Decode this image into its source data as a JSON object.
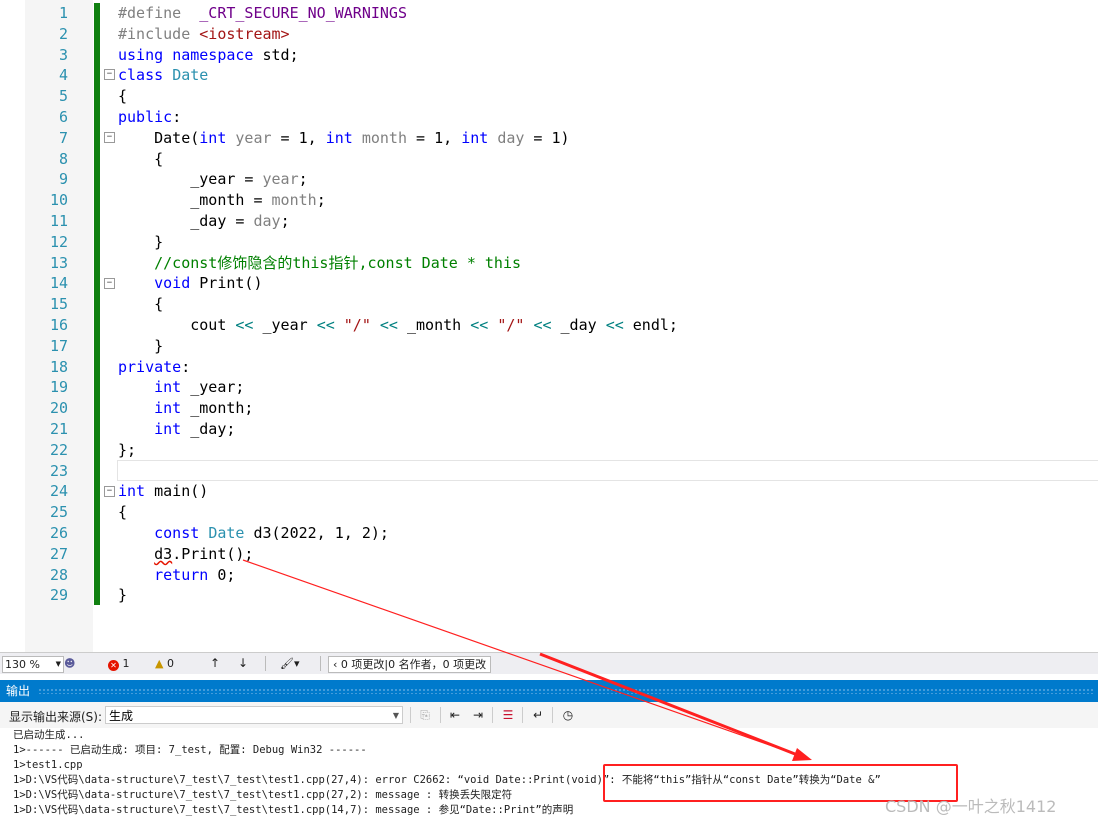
{
  "editor": {
    "lines": [
      {
        "n": "1",
        "tokens": [
          {
            "t": "#define",
            "c": "pp"
          },
          {
            "t": "  "
          },
          {
            "t": "_CRT_SECURE_NO_WARNINGS",
            "c": "macro"
          }
        ]
      },
      {
        "n": "2",
        "tokens": [
          {
            "t": "#include ",
            "c": "pp"
          },
          {
            "t": "<iostream>",
            "c": "str"
          }
        ]
      },
      {
        "n": "3",
        "tokens": [
          {
            "t": "using",
            "c": "kw"
          },
          {
            "t": " "
          },
          {
            "t": "namespace",
            "c": "kw"
          },
          {
            "t": " std;"
          }
        ]
      },
      {
        "n": "4",
        "tokens": [
          {
            "t": "class",
            "c": "kw"
          },
          {
            "t": " "
          },
          {
            "t": "Date",
            "c": "type"
          }
        ]
      },
      {
        "n": "5",
        "tokens": [
          {
            "t": "{"
          }
        ]
      },
      {
        "n": "6",
        "tokens": [
          {
            "t": "public",
            "c": "kw"
          },
          {
            "t": ":"
          }
        ]
      },
      {
        "n": "7",
        "tokens": [
          {
            "t": "    Date("
          },
          {
            "t": "int",
            "c": "kw"
          },
          {
            "t": " "
          },
          {
            "t": "year",
            "c": "param"
          },
          {
            "t": " = 1, "
          },
          {
            "t": "int",
            "c": "kw"
          },
          {
            "t": " "
          },
          {
            "t": "month",
            "c": "param"
          },
          {
            "t": " = 1, "
          },
          {
            "t": "int",
            "c": "kw"
          },
          {
            "t": " "
          },
          {
            "t": "day",
            "c": "param"
          },
          {
            "t": " = 1)"
          }
        ]
      },
      {
        "n": "8",
        "tokens": [
          {
            "t": "    {"
          }
        ]
      },
      {
        "n": "9",
        "tokens": [
          {
            "t": "        _year = "
          },
          {
            "t": "year",
            "c": "param"
          },
          {
            "t": ";"
          }
        ]
      },
      {
        "n": "10",
        "tokens": [
          {
            "t": "        _month = "
          },
          {
            "t": "month",
            "c": "param"
          },
          {
            "t": ";"
          }
        ]
      },
      {
        "n": "11",
        "tokens": [
          {
            "t": "        _day = "
          },
          {
            "t": "day",
            "c": "param"
          },
          {
            "t": ";"
          }
        ]
      },
      {
        "n": "12",
        "tokens": [
          {
            "t": "    }"
          }
        ]
      },
      {
        "n": "13",
        "tokens": [
          {
            "t": "    //const修饰隐含的this指针,const Date * this",
            "c": "com"
          }
        ]
      },
      {
        "n": "14",
        "tokens": [
          {
            "t": "    "
          },
          {
            "t": "void",
            "c": "kw"
          },
          {
            "t": " Print()"
          }
        ]
      },
      {
        "n": "15",
        "tokens": [
          {
            "t": "    {"
          }
        ]
      },
      {
        "n": "16",
        "tokens": [
          {
            "t": "        cout "
          },
          {
            "t": "<<",
            "c": "op"
          },
          {
            "t": " _year "
          },
          {
            "t": "<<",
            "c": "op"
          },
          {
            "t": " "
          },
          {
            "t": "\"/\"",
            "c": "str"
          },
          {
            "t": " "
          },
          {
            "t": "<<",
            "c": "op"
          },
          {
            "t": " _month "
          },
          {
            "t": "<<",
            "c": "op"
          },
          {
            "t": " "
          },
          {
            "t": "\"/\"",
            "c": "str"
          },
          {
            "t": " "
          },
          {
            "t": "<<",
            "c": "op"
          },
          {
            "t": " _day "
          },
          {
            "t": "<<",
            "c": "op"
          },
          {
            "t": " endl;"
          }
        ]
      },
      {
        "n": "17",
        "tokens": [
          {
            "t": "    }"
          }
        ]
      },
      {
        "n": "18",
        "tokens": [
          {
            "t": "private",
            "c": "kw"
          },
          {
            "t": ":"
          }
        ]
      },
      {
        "n": "19",
        "tokens": [
          {
            "t": "    "
          },
          {
            "t": "int",
            "c": "kw"
          },
          {
            "t": " _year;"
          }
        ]
      },
      {
        "n": "20",
        "tokens": [
          {
            "t": "    "
          },
          {
            "t": "int",
            "c": "kw"
          },
          {
            "t": " _month;"
          }
        ]
      },
      {
        "n": "21",
        "tokens": [
          {
            "t": "    "
          },
          {
            "t": "int",
            "c": "kw"
          },
          {
            "t": " _day;"
          }
        ]
      },
      {
        "n": "22",
        "tokens": [
          {
            "t": "};"
          }
        ]
      },
      {
        "n": "23",
        "tokens": []
      },
      {
        "n": "24",
        "tokens": [
          {
            "t": "int",
            "c": "kw"
          },
          {
            "t": " main()"
          }
        ]
      },
      {
        "n": "25",
        "tokens": [
          {
            "t": "{"
          }
        ]
      },
      {
        "n": "26",
        "tokens": [
          {
            "t": "    "
          },
          {
            "t": "const",
            "c": "kw"
          },
          {
            "t": " "
          },
          {
            "t": "Date",
            "c": "type"
          },
          {
            "t": " d3(2022, 1, 2);"
          }
        ]
      },
      {
        "n": "27",
        "tokens": [
          {
            "t": "    "
          },
          {
            "t": "d3",
            "c": "squig"
          },
          {
            "t": ".Print();"
          }
        ]
      },
      {
        "n": "28",
        "tokens": [
          {
            "t": "    "
          },
          {
            "t": "return",
            "c": "kw"
          },
          {
            "t": " 0;"
          }
        ]
      },
      {
        "n": "29",
        "tokens": [
          {
            "t": "}"
          }
        ]
      }
    ]
  },
  "statusbar": {
    "zoom": "130 %",
    "errors": "1",
    "warnings": "0",
    "changes": "0 项更改|0 名作者，0 项更改"
  },
  "output": {
    "title": "输出",
    "source_label": "显示输出来源(S):",
    "source_value": "生成",
    "lines": [
      "已启动生成...",
      "1>------ 已启动生成: 项目: 7_test, 配置: Debug Win32 ------",
      "1>test1.cpp",
      "1>D:\\VS代码\\data-structure\\7_test\\7_test\\test1.cpp(27,4): error C2662: “void Date::Print(void)”: 不能将“this”指针从“const Date”转换为“Date &”",
      "1>D:\\VS代码\\data-structure\\7_test\\7_test\\test1.cpp(27,2): message : 转换丢失限定符",
      "1>D:\\VS代码\\data-structure\\7_test\\7_test\\test1.cpp(14,7): message : 参见“Date::Print”的声明"
    ]
  },
  "watermark": "CSDN @一叶之秋1412",
  "colors": {
    "accent": "#007acc",
    "change_bar": "#108010",
    "annotation": "#ff2020",
    "error": "#e51400"
  }
}
